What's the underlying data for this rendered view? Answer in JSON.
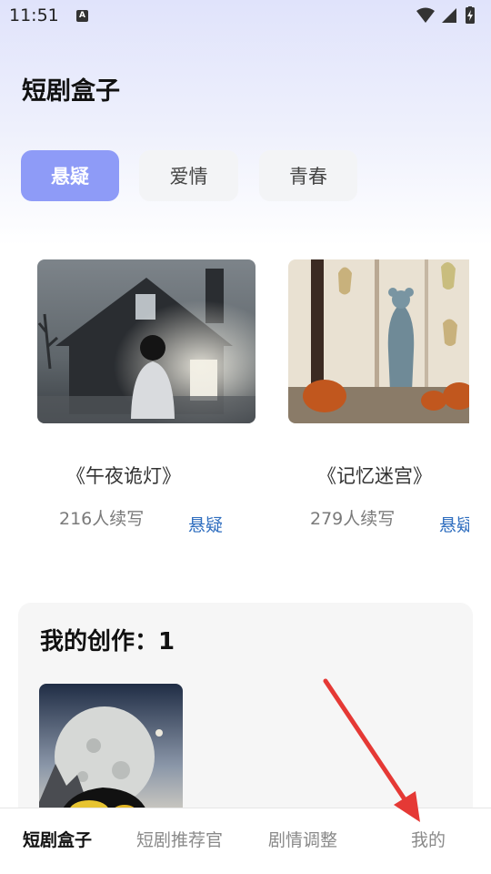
{
  "status_bar": {
    "time": "11:51",
    "notification_letter": "A",
    "icons": [
      "wifi-icon",
      "signal-icon",
      "battery-charging-icon"
    ]
  },
  "app": {
    "title": "短剧盒子"
  },
  "tabs": [
    {
      "label": "悬疑",
      "active": true
    },
    {
      "label": "爱情",
      "active": false
    },
    {
      "label": "青春",
      "active": false
    }
  ],
  "stories": [
    {
      "title": "《午夜诡灯》",
      "count": "216人续写",
      "genre": "悬疑"
    },
    {
      "title": "《记忆迷宫》",
      "count": "279人续写",
      "genre": "悬疑"
    }
  ],
  "my_works": {
    "label": "我的创作：1"
  },
  "bottom_nav": [
    {
      "label": "短剧盒子",
      "active": true
    },
    {
      "label": "短剧推荐官",
      "active": false
    },
    {
      "label": "剧情调整",
      "active": false
    },
    {
      "label": "我的",
      "active": false
    }
  ],
  "colors": {
    "accent": "#8e9bf7",
    "genre_link": "#2f6ebf",
    "annotation_arrow": "#e53935"
  }
}
